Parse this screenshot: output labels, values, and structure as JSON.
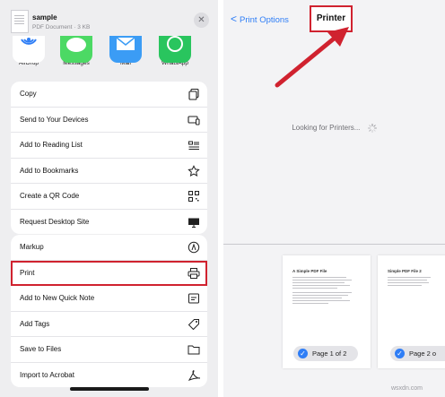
{
  "share": {
    "file_name": "sample",
    "file_meta": "PDF Document · 3 KB",
    "close_glyph": "✕",
    "apps": [
      {
        "label": "AirDrop"
      },
      {
        "label": "Messages"
      },
      {
        "label": "Mail"
      },
      {
        "label": "WhatsApp"
      }
    ],
    "group1": [
      {
        "label": "Copy",
        "icon": "copy-icon"
      },
      {
        "label": "Send to Your Devices",
        "icon": "devices-icon"
      },
      {
        "label": "Add to Reading List",
        "icon": "reading-list-icon"
      },
      {
        "label": "Add to Bookmarks",
        "icon": "star-icon"
      },
      {
        "label": "Create a QR Code",
        "icon": "qr-code-icon"
      },
      {
        "label": "Request Desktop Site",
        "icon": "desktop-icon"
      }
    ],
    "group2": [
      {
        "label": "Markup",
        "icon": "markup-icon"
      },
      {
        "label": "Print",
        "icon": "printer-icon"
      },
      {
        "label": "Add to New Quick Note",
        "icon": "quick-note-icon"
      },
      {
        "label": "Add Tags",
        "icon": "tag-icon"
      },
      {
        "label": "Save to Files",
        "icon": "folder-icon"
      },
      {
        "label": "Import to Acrobat",
        "icon": "acrobat-icon"
      }
    ]
  },
  "print": {
    "back_label": "Print Options",
    "back_glyph": "<",
    "title": "Printer",
    "status": "Looking for Printers...",
    "pages": [
      {
        "heading": "A Simple PDF File",
        "label": "Page 1 of 2"
      },
      {
        "heading": "Simple PDF File 2",
        "label": "Page 2 o"
      }
    ]
  },
  "watermark": "wsxdn.com",
  "colors": {
    "accent": "#2f7ef6",
    "highlight": "#d0222f"
  }
}
